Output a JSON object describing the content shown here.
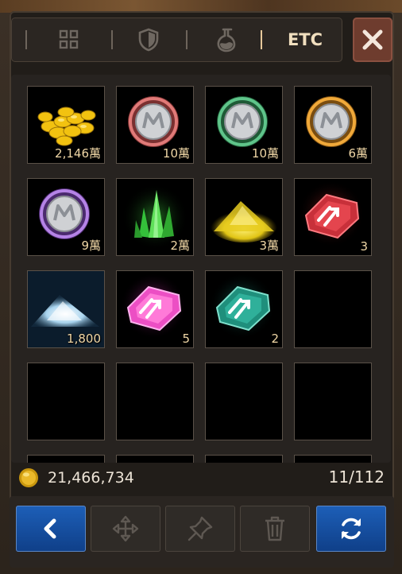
{
  "tabs": [
    {
      "icon": "grid-icon",
      "label": ""
    },
    {
      "icon": "shield-icon",
      "label": ""
    },
    {
      "icon": "potion-icon",
      "label": ""
    },
    {
      "icon": "",
      "label": "ETC"
    }
  ],
  "active_tab": "ETC",
  "close_icon": "close-icon",
  "slots": [
    {
      "item": "gold-coins",
      "qty": "2,146萬"
    },
    {
      "item": "red-coin",
      "qty": "10萬"
    },
    {
      "item": "green-coin",
      "qty": "10萬"
    },
    {
      "item": "gold-coin",
      "qty": "6萬"
    },
    {
      "item": "purple-coin",
      "qty": "9萬"
    },
    {
      "item": "green-crystal",
      "qty": "2萬"
    },
    {
      "item": "gold-dust",
      "qty": "3萬"
    },
    {
      "item": "red-stone",
      "qty": "3"
    },
    {
      "item": "silver-dust",
      "qty": "1,800"
    },
    {
      "item": "pink-stone",
      "qty": "5"
    },
    {
      "item": "teal-stone",
      "qty": "2"
    },
    {
      "item": "empty",
      "qty": ""
    }
  ],
  "money": {
    "icon": "gold-coin-icon",
    "value": "21,466,734"
  },
  "capacity": "11/112",
  "buttons": [
    {
      "icon": "back-arrow-icon",
      "style": "blue"
    },
    {
      "icon": "move-icon",
      "style": "gray"
    },
    {
      "icon": "pin-icon",
      "style": "gray"
    },
    {
      "icon": "trash-icon",
      "style": "gray"
    },
    {
      "icon": "refresh-icon",
      "style": "blue"
    }
  ],
  "colors": {
    "accent_blue": "#1d5fb8",
    "close_red": "#6e3c2e",
    "qty_text": "#f0d7a6",
    "active_tab_text": "#f1dfbf"
  }
}
